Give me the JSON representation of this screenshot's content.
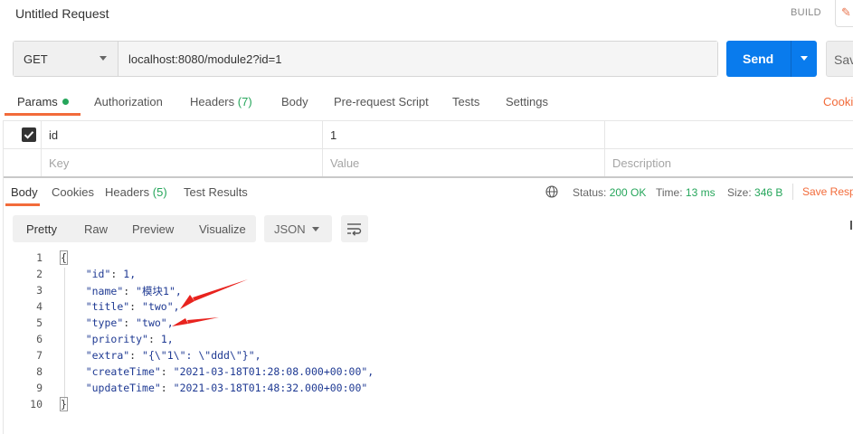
{
  "header": {
    "title": "Untitled Request",
    "build_label": "BUILD"
  },
  "request": {
    "method": "GET",
    "url": "localhost:8080/module2?id=1",
    "send_label": "Send",
    "save_label": "Save"
  },
  "request_tabs": [
    {
      "label": "Params",
      "count": ""
    },
    {
      "label": "Authorization",
      "count": ""
    },
    {
      "label": "Headers",
      "count": "(7)"
    },
    {
      "label": "Body",
      "count": ""
    },
    {
      "label": "Pre-request Script",
      "count": ""
    },
    {
      "label": "Tests",
      "count": ""
    },
    {
      "label": "Settings",
      "count": ""
    }
  ],
  "cookies_label": "Cookies",
  "params": {
    "rows": [
      {
        "key": "id",
        "value": "1",
        "description": ""
      }
    ],
    "placeholders": {
      "key": "Key",
      "value": "Value",
      "description": "Description"
    }
  },
  "response_tabs": [
    {
      "label": "Body",
      "count": ""
    },
    {
      "label": "Cookies",
      "count": ""
    },
    {
      "label": "Headers",
      "count": "(5)"
    },
    {
      "label": "Test Results",
      "count": ""
    }
  ],
  "response_status": {
    "status_label": "Status:",
    "status_value": "200 OK",
    "time_label": "Time:",
    "time_value": "13 ms",
    "size_label": "Size:",
    "size_value": "346 B",
    "save_response_label": "Save Response"
  },
  "view_buttons": [
    "Pretty",
    "Raw",
    "Preview",
    "Visualize"
  ],
  "format": "JSON",
  "response_body": [
    "{",
    "    \"id\": 1,",
    "    \"name\": \"模块1\",",
    "    \"title\": \"two\",",
    "    \"type\": \"two\",",
    "    \"priority\": 1,",
    "    \"extra\": \"{\\\"1\\\": \\\"ddd\\\"}\",",
    "    \"createTime\": \"2021-03-18T01:28:08.000+00:00\",",
    "    \"updateTime\": \"2021-03-18T01:48:32.000+00:00\"",
    "}"
  ],
  "colors": {
    "accent": "#f26b3a",
    "send_blue": "#097bed",
    "success_green": "#26a65b",
    "annotation_red": "#e8231e"
  }
}
